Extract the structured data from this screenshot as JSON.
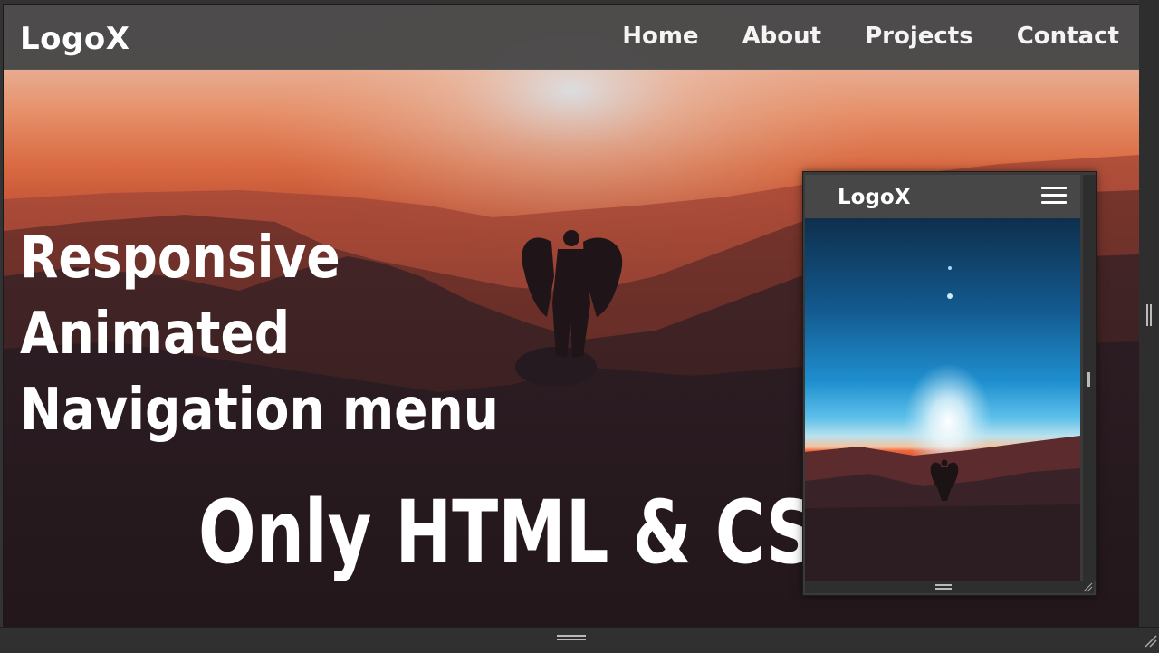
{
  "navbar": {
    "logo": "LogoX",
    "links": [
      "Home",
      "About",
      "Projects",
      "Contact"
    ]
  },
  "hero": {
    "headline": [
      "Responsive",
      "Animated",
      "Navigation menu"
    ],
    "tagline": "Only HTML & CSS"
  },
  "mobile_preview": {
    "logo": "LogoX",
    "menu_icon": "hamburger-icon"
  },
  "colors": {
    "navbar_bg": "#484848",
    "text": "#ffffff",
    "sunset_orange": "#f0663a",
    "sky_blue": "#1f8fcf"
  }
}
